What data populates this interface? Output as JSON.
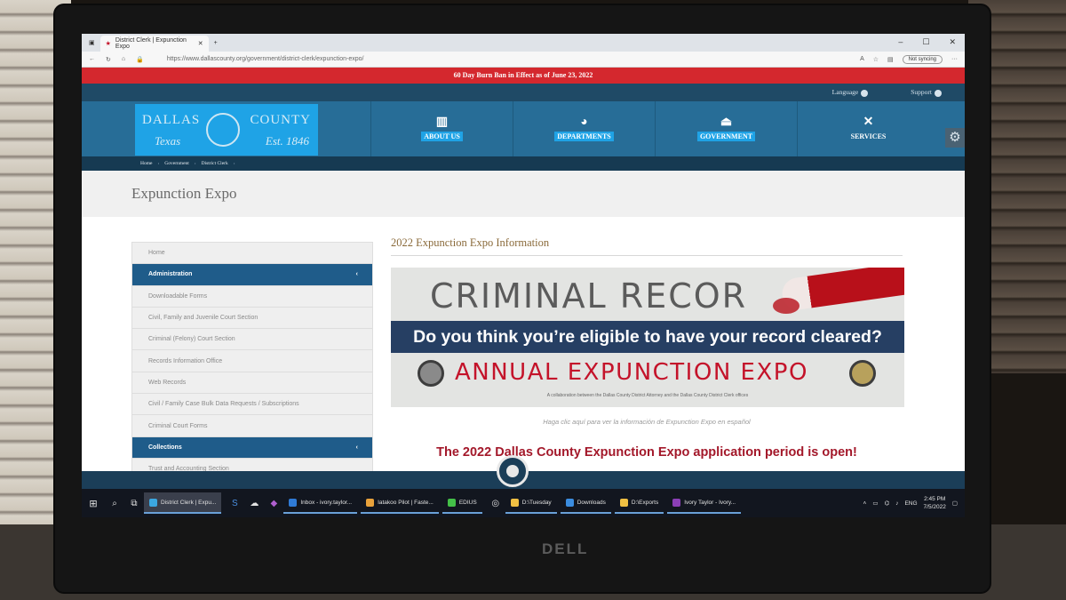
{
  "browser": {
    "tab_title": "District Clerk | Expunction Expo",
    "url": "https://www.dallascounty.org/government/district-clerk/expunction-expo/",
    "sync_label": "Not syncing"
  },
  "site": {
    "alert_banner": "60 Day Burn Ban in Effect as of June 23, 2022",
    "utility": {
      "language": "Language",
      "support": "Support"
    },
    "logo": {
      "left_top": "DALLAS",
      "right_top": "COUNTY",
      "left_bottom": "Texas",
      "right_bottom": "Est. 1846"
    },
    "nav": [
      {
        "label": "ABOUT US",
        "icon": "building-icon"
      },
      {
        "label": "DEPARTMENTS",
        "icon": "pie-chart-icon"
      },
      {
        "label": "GOVERNMENT",
        "icon": "capitol-icon"
      },
      {
        "label": "SERVICES",
        "icon": "tools-icon"
      }
    ],
    "breadcrumb": [
      "Home",
      "Government",
      "District Clerk"
    ],
    "page_title": "Expunction Expo",
    "sidebar": [
      {
        "label": "Home",
        "type": "item"
      },
      {
        "label": "Administration",
        "type": "head"
      },
      {
        "label": "Downloadable Forms",
        "type": "item"
      },
      {
        "label": "Civil, Family and Juvenile Court Section",
        "type": "item"
      },
      {
        "label": "Criminal (Felony) Court Section",
        "type": "item"
      },
      {
        "label": "Records Information Office",
        "type": "item"
      },
      {
        "label": "Web Records",
        "type": "item"
      },
      {
        "label": "Civil / Family Case Bulk Data Requests / Subscriptions",
        "type": "item"
      },
      {
        "label": "Criminal Court Forms",
        "type": "item"
      },
      {
        "label": "Collections",
        "type": "head"
      },
      {
        "label": "Trust and Accounting Section",
        "type": "item"
      }
    ],
    "main": {
      "heading": "2022 Expunction Expo Information",
      "promo": {
        "big_text": "CRIMINAL RECOR",
        "question": "Do you think you’re eligible to have your record cleared?",
        "expo": "ANNUAL EXPUNCTION EXPO",
        "collab": "A collaboration between the Dallas County District Attorney and the Dallas County District Clerk offices"
      },
      "spanish_link": "Haga clic aquí para ver la información de Expunction Expo en español",
      "open_message": "The 2022 Dallas County Expunction Expo application period is open!"
    }
  },
  "taskbar": {
    "apps": [
      {
        "label": "District Clerk | Expu...",
        "color": "#3ba7e0",
        "active": true
      },
      {
        "label": "Inbox - ivory.taylor...",
        "color": "#2f7bd6",
        "active": false
      },
      {
        "label": "Iatakoo Pilot | Faste...",
        "color": "#e9a23b",
        "active": false
      },
      {
        "label": "EDIUS",
        "color": "#44c048",
        "active": false
      },
      {
        "label": "D:\\Tuesday",
        "color": "#f0c043",
        "active": false
      },
      {
        "label": "Downloads",
        "color": "#3b8de0",
        "active": false
      },
      {
        "label": "D:\\Exports",
        "color": "#f0c043",
        "active": false
      },
      {
        "label": "Ivory Taylor - Ivory...",
        "color": "#8b3fb6",
        "active": false
      }
    ],
    "lang": "ENG",
    "time": "2:45 PM",
    "date": "7/5/2022"
  },
  "monitor_brand": "DELL"
}
